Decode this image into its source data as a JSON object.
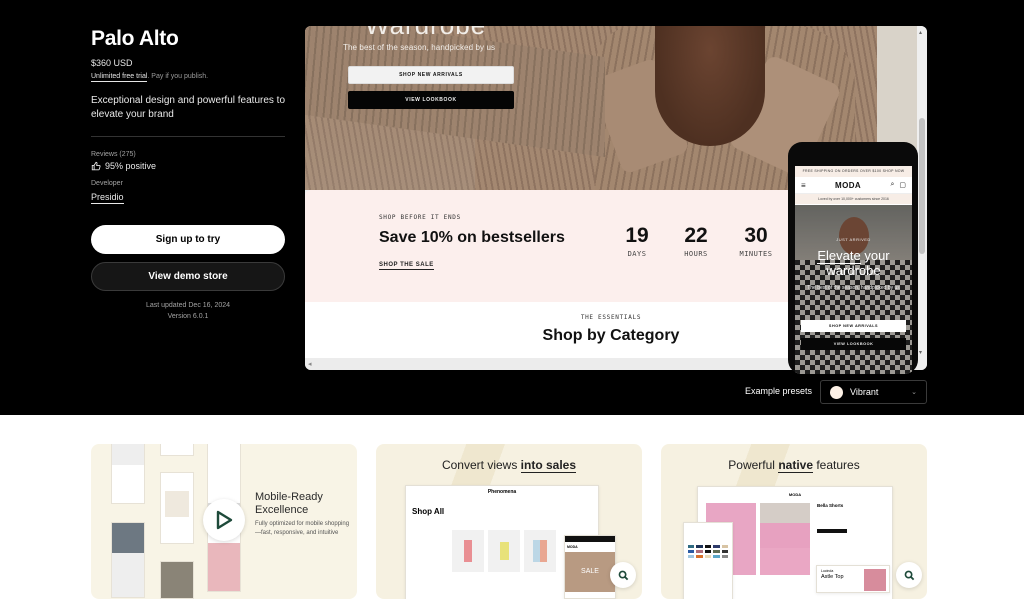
{
  "app": {
    "title": "Palo Alto",
    "price": "$360 USD",
    "trial_link": "Unlimited free trial",
    "trial_note": ". Pay if you publish.",
    "tagline": "Exceptional design and powerful features to elevate your brand",
    "reviews_label": "Reviews (275)",
    "rating": "95% positive",
    "developer_label": "Developer",
    "developer": "Presidio",
    "primary_button": "Sign up to try",
    "secondary_button": "View demo store",
    "last_updated": "Last updated Dec 16, 2024",
    "version": "Version 6.0.1"
  },
  "preview": {
    "hero_heading": "Wardrobe",
    "hero_subtitle": "The best of the season, handpicked by us",
    "hero_primary": "SHOP NEW ARRIVALS",
    "hero_secondary": "VIEW LOOKBOOK",
    "sale_eyebrow": "SHOP BEFORE IT ENDS",
    "sale_title": "Save 10% on bestsellers",
    "sale_link": "SHOP THE SALE",
    "countdown": [
      {
        "value": "19",
        "label": "DAYS"
      },
      {
        "value": "22",
        "label": "HOURS"
      },
      {
        "value": "30",
        "label": "MINUTES"
      }
    ],
    "category_eyebrow": "THE ESSENTIALS",
    "category_title": "Shop by Category"
  },
  "phone": {
    "promo": "FREE SHIPPING ON ORDERS OVER $100 SHOP NOW",
    "logo": "MODA",
    "loved": "Loved by over 10,000+ customers since 2016",
    "eyebrow": "JUST ARRIVED",
    "title_underlined": "Elevate",
    "title_rest": " your wardrobe",
    "subtitle": "The best of the season, handpicked by us",
    "primary": "SHOP NEW ARRIVALS",
    "secondary": "VIEW LOOKBOOK"
  },
  "presets": {
    "label": "Example presets",
    "selected": "Vibrant",
    "swatch_color": "#fdf1e6"
  },
  "cards": [
    {
      "title": "Mobile-Ready Excellence",
      "description": "Fully optimized for mobile shopping—fast, responsive, and intuitive"
    },
    {
      "title_pre": "Convert views ",
      "title_bold": "into sales",
      "title_post": "",
      "shop_brand": "Phenomena",
      "shop_heading": "Shop All",
      "overlay_brand": "MODA",
      "overlay_banner": "SALE"
    },
    {
      "title_pre": "Powerful ",
      "title_bold": "native",
      "title_post": " features",
      "shop_brand": "MODA",
      "product_name": "Bella Shorts",
      "popup_label": "Lucinda",
      "popup_product": "Astle Top"
    }
  ]
}
